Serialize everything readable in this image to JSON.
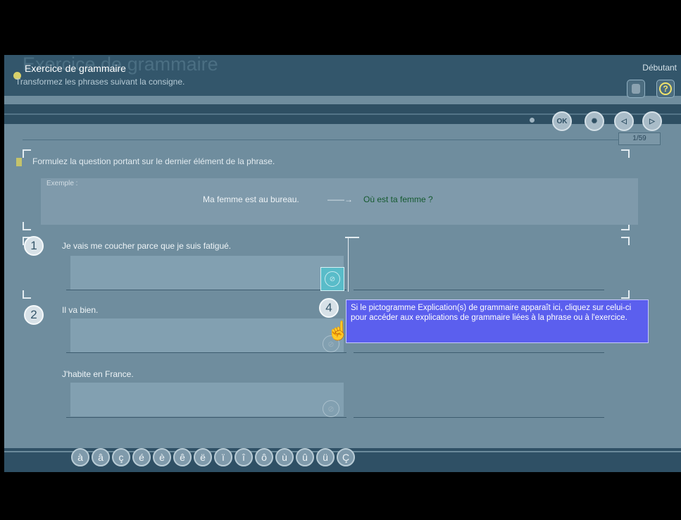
{
  "header": {
    "ghost_title": "Exercice de grammaire",
    "title": "Exercice de grammaire",
    "subtitle": "Transformez les phrases suivant la consigne.",
    "level": "Débutant",
    "help_label": "?"
  },
  "nav": {
    "ok_label": "OK",
    "counter": "1/59"
  },
  "instruction": "Formulez la question portant sur le dernier élément de la phrase.",
  "example": {
    "label": "Exemple :",
    "source": "Ma femme est au bureau.",
    "arrow": "——→",
    "answer": "Où est ta femme ?"
  },
  "items": [
    {
      "number": "1",
      "sentence": "Je vais me coucher parce que je suis fatigué."
    },
    {
      "number": "2",
      "sentence": "Il va bien."
    },
    {
      "number": "",
      "sentence": "J'habite en France."
    }
  ],
  "callout": {
    "number": "4",
    "text": "Si le pictogramme Explication(s) de grammaire apparaît ici, cliquez sur celui-ci pour accéder aux explications de grammaire liées à la phrase ou à l'exercice."
  },
  "special_chars": [
    "à",
    "â",
    "ç",
    "é",
    "è",
    "ê",
    "ë",
    "ï",
    "î",
    "ô",
    "ù",
    "û",
    "ü",
    "Ç"
  ],
  "colors": {
    "background": "#6f8d9e",
    "header": "#33566b",
    "tooltip": "#5b5fee",
    "answer_green": "#155a2f"
  }
}
